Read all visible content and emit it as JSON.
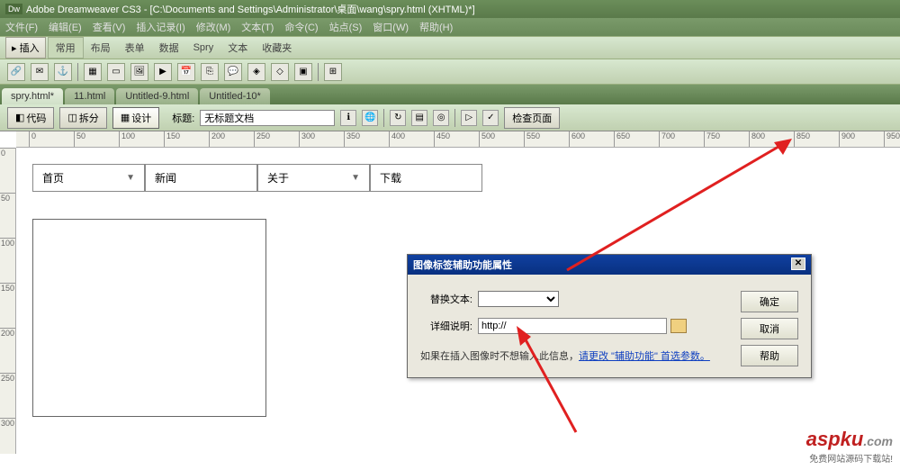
{
  "titlebar": {
    "prefix": "Dw",
    "text": "Adobe Dreamweaver CS3 - [C:\\Documents and Settings\\Administrator\\桌面\\wang\\spry.html (XHTML)*]"
  },
  "menubar": [
    "文件(F)",
    "编辑(E)",
    "查看(V)",
    "插入记录(I)",
    "修改(M)",
    "文本(T)",
    "命令(C)",
    "站点(S)",
    "窗口(W)",
    "帮助(H)"
  ],
  "insertbar": {
    "insert_label": "▸ 插入",
    "tabs": [
      "常用",
      "布局",
      "表单",
      "数据",
      "Spry",
      "文本",
      "收藏夹"
    ],
    "active": 0
  },
  "filetabs": [
    {
      "label": "spry.html*",
      "active": true
    },
    {
      "label": "11.html",
      "active": false
    },
    {
      "label": "Untitled-9.html",
      "active": false
    },
    {
      "label": "Untitled-10*",
      "active": false
    }
  ],
  "doctoolbar": {
    "views": [
      {
        "label": "代码",
        "icon": "◧"
      },
      {
        "label": "拆分",
        "icon": "◫"
      },
      {
        "label": "设计",
        "icon": "▦"
      }
    ],
    "active_view": 2,
    "title_label": "标题:",
    "title_value": "无标题文档",
    "check_page": "检查页面"
  },
  "ruler_ticks": [
    0,
    50,
    100,
    150,
    200,
    250,
    300,
    350,
    400,
    450,
    500,
    550,
    600,
    650,
    700,
    750,
    800,
    850,
    900,
    950
  ],
  "vruler_ticks": [
    0,
    50,
    100,
    150,
    200,
    250,
    300
  ],
  "sprymenu": [
    {
      "label": "首页",
      "arrow": true
    },
    {
      "label": "新闻",
      "arrow": false
    },
    {
      "label": "关于",
      "arrow": true
    },
    {
      "label": "下载",
      "arrow": false
    }
  ],
  "dialog": {
    "title": "图像标签辅助功能属性",
    "alt_label": "替换文本:",
    "alt_value": "",
    "desc_label": "详细说明:",
    "desc_value": "http://",
    "hint_prefix": "如果在插入图像时不想输入此信息，",
    "hint_link": "请更改 \"辅助功能\" 首选参数。",
    "ok": "确定",
    "cancel": "取消",
    "help": "帮助"
  },
  "watermark": {
    "brand_a": "aspku",
    "brand_b": ".com",
    "sub": "免费网站源码下载站!"
  }
}
